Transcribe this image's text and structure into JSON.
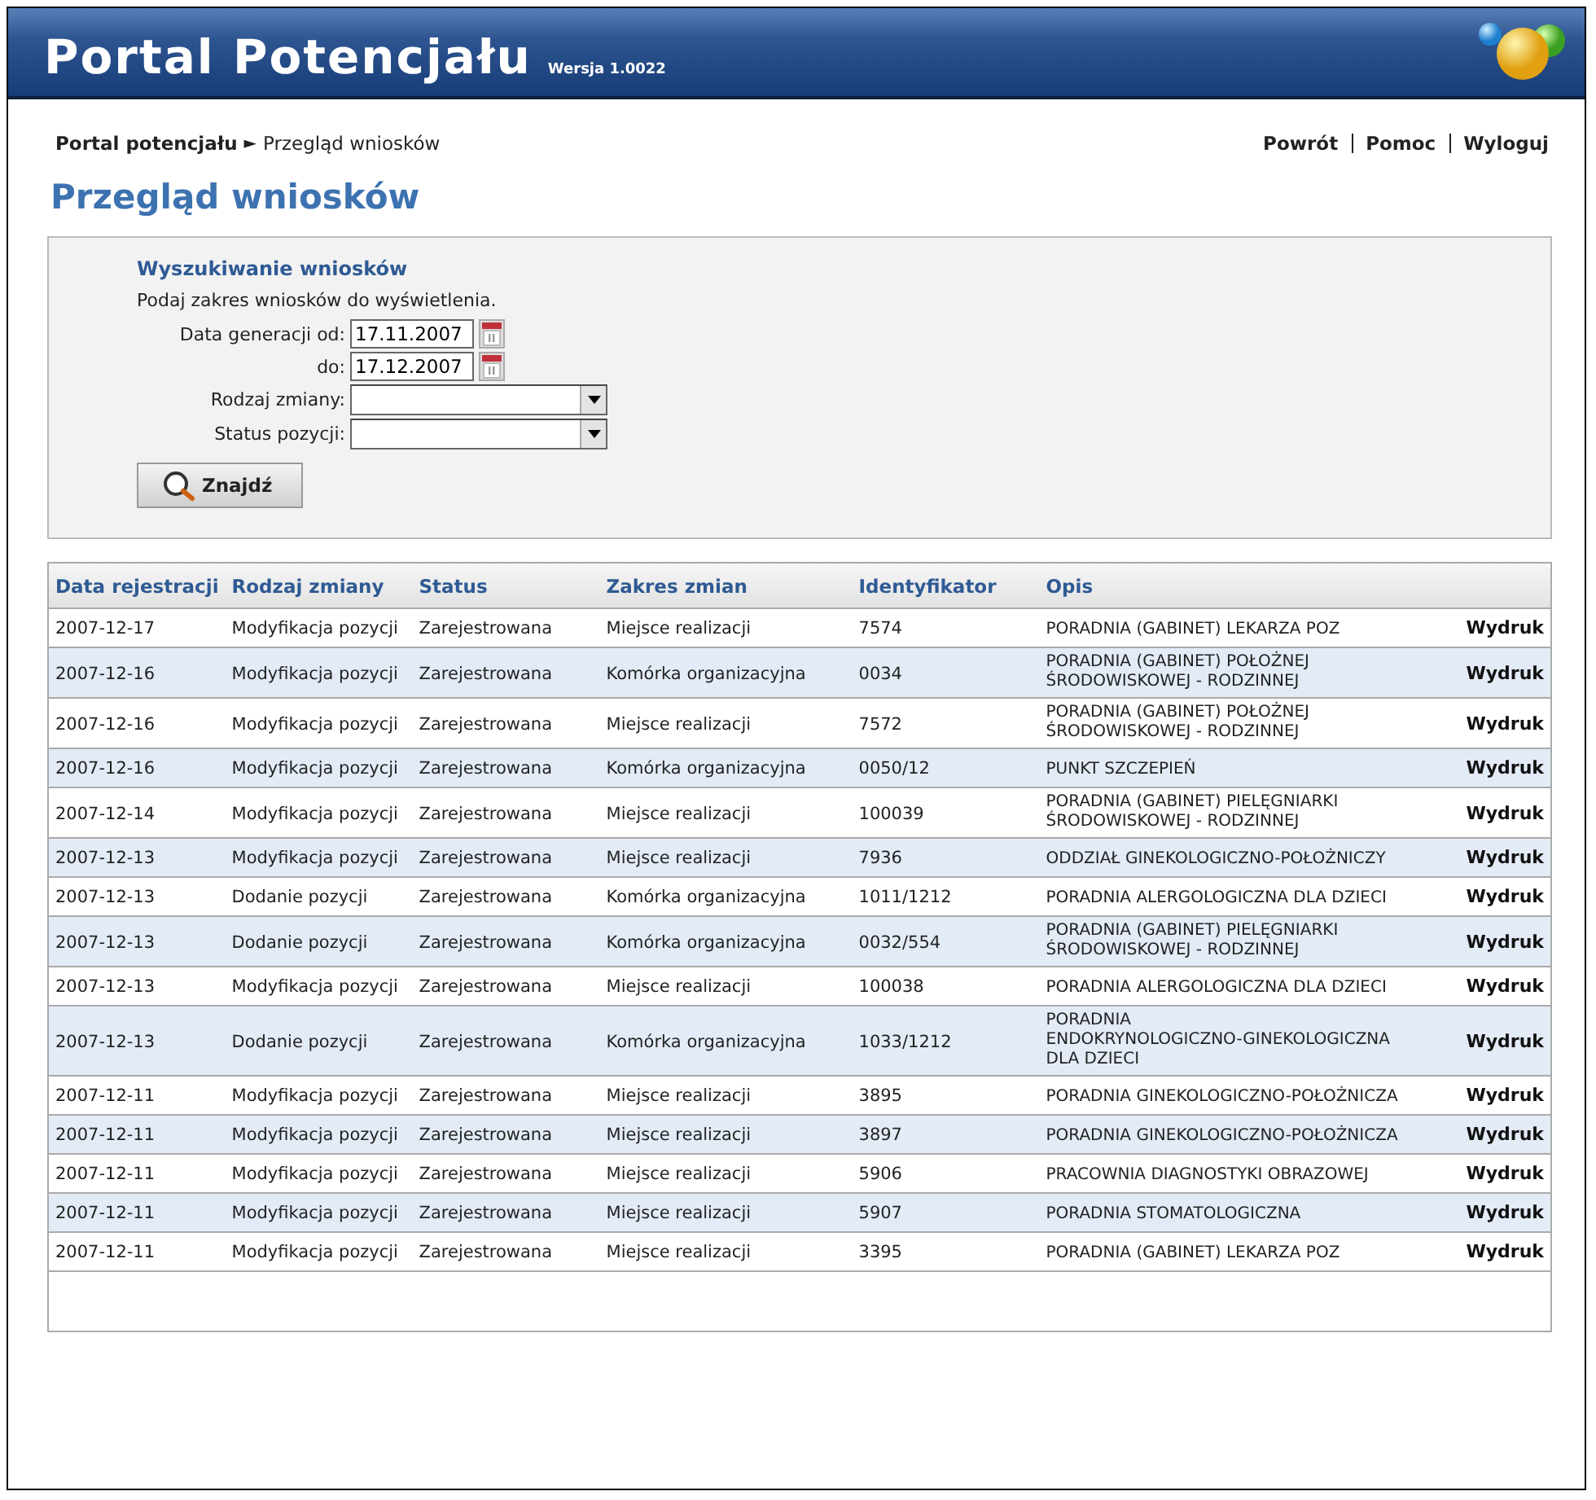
{
  "header": {
    "title": "Portal Potencjału",
    "version": "Wersja 1.0022"
  },
  "breadcrumb": {
    "items": [
      "Portal potencjału",
      "Przegląd wniosków"
    ],
    "separator": "►"
  },
  "top_links": [
    "Powrót",
    "Pomoc",
    "Wyloguj"
  ],
  "page_title": "Przegląd wniosków",
  "search": {
    "title": "Wyszukiwanie wniosków",
    "hint": "Podaj zakres wniosków do wyświetlenia.",
    "fields": [
      {
        "kind": "date",
        "label": "Data generacji od:",
        "value": "17.11.2007"
      },
      {
        "kind": "date",
        "label": "do:",
        "value": "17.12.2007"
      },
      {
        "kind": "select",
        "label": "Rodzaj zmiany:"
      },
      {
        "kind": "select",
        "label": "Status pozycji:"
      }
    ],
    "button": "Znajdź"
  },
  "table": {
    "columns": [
      "Data rejestracji",
      "Rodzaj zmiany",
      "Status",
      "Zakres zmian",
      "Identyfikator",
      "Opis"
    ],
    "rows": [
      {
        "cells": [
          "2007-12-17",
          "Modyfikacja pozycji",
          "Zarejestrowana",
          "Miejsce realizacji",
          "7574",
          "PORADNIA (GABINET) LEKARZA POZ"
        ],
        "action": "Wydruk"
      },
      {
        "cells": [
          "2007-12-16",
          "Modyfikacja pozycji",
          "Zarejestrowana",
          "Komórka organizacyjna",
          "0034",
          "PORADNIA (GABINET) POŁOŻNEJ\nŚRODOWISKOWEJ - RODZINNEJ"
        ],
        "action": "Wydruk"
      },
      {
        "cells": [
          "2007-12-16",
          "Modyfikacja pozycji",
          "Zarejestrowana",
          "Miejsce realizacji",
          "7572",
          "PORADNIA (GABINET) POŁOŻNEJ\nŚRODOWISKOWEJ - RODZINNEJ"
        ],
        "action": "Wydruk"
      },
      {
        "cells": [
          "2007-12-16",
          "Modyfikacja pozycji",
          "Zarejestrowana",
          "Komórka organizacyjna",
          "0050/12",
          "PUNKT SZCZEPIEŃ"
        ],
        "action": "Wydruk"
      },
      {
        "cells": [
          "2007-12-14",
          "Modyfikacja pozycji",
          "Zarejestrowana",
          "Miejsce realizacji",
          "100039",
          "PORADNIA (GABINET) PIELĘGNIARKI\nŚRODOWISKOWEJ - RODZINNEJ"
        ],
        "action": "Wydruk"
      },
      {
        "cells": [
          "2007-12-13",
          "Modyfikacja pozycji",
          "Zarejestrowana",
          "Miejsce realizacji",
          "7936",
          "ODDZIAŁ GINEKOLOGICZNO-POŁOŻNICZY"
        ],
        "action": "Wydruk"
      },
      {
        "cells": [
          "2007-12-13",
          "Dodanie pozycji",
          "Zarejestrowana",
          "Komórka organizacyjna",
          "1011/1212",
          "PORADNIA ALERGOLOGICZNA DLA DZIECI"
        ],
        "action": "Wydruk"
      },
      {
        "cells": [
          "2007-12-13",
          "Dodanie pozycji",
          "Zarejestrowana",
          "Komórka organizacyjna",
          "0032/554",
          "PORADNIA (GABINET) PIELĘGNIARKI\nŚRODOWISKOWEJ - RODZINNEJ"
        ],
        "action": "Wydruk"
      },
      {
        "cells": [
          "2007-12-13",
          "Modyfikacja pozycji",
          "Zarejestrowana",
          "Miejsce realizacji",
          "100038",
          "PORADNIA ALERGOLOGICZNA DLA DZIECI"
        ],
        "action": "Wydruk"
      },
      {
        "cells": [
          "2007-12-13",
          "Dodanie pozycji",
          "Zarejestrowana",
          "Komórka organizacyjna",
          "1033/1212",
          "PORADNIA\nENDOKRYNOLOGICZNO-GINEKOLOGICZNA\nDLA DZIECI"
        ],
        "action": "Wydruk"
      },
      {
        "cells": [
          "2007-12-11",
          "Modyfikacja pozycji",
          "Zarejestrowana",
          "Miejsce realizacji",
          "3895",
          "PORADNIA GINEKOLOGICZNO-POŁOŻNICZA"
        ],
        "action": "Wydruk"
      },
      {
        "cells": [
          "2007-12-11",
          "Modyfikacja pozycji",
          "Zarejestrowana",
          "Miejsce realizacji",
          "3897",
          "PORADNIA GINEKOLOGICZNO-POŁOŻNICZA"
        ],
        "action": "Wydruk"
      },
      {
        "cells": [
          "2007-12-11",
          "Modyfikacja pozycji",
          "Zarejestrowana",
          "Miejsce realizacji",
          "5906",
          "PRACOWNIA DIAGNOSTYKI OBRAZOWEJ"
        ],
        "action": "Wydruk"
      },
      {
        "cells": [
          "2007-12-11",
          "Modyfikacja pozycji",
          "Zarejestrowana",
          "Miejsce realizacji",
          "5907",
          "PORADNIA STOMATOLOGICZNA"
        ],
        "action": "Wydruk"
      },
      {
        "cells": [
          "2007-12-11",
          "Modyfikacja pozycji",
          "Zarejestrowana",
          "Miejsce realizacji",
          "3395",
          "PORADNIA (GABINET) LEKARZA POZ"
        ],
        "action": "Wydruk"
      }
    ]
  }
}
